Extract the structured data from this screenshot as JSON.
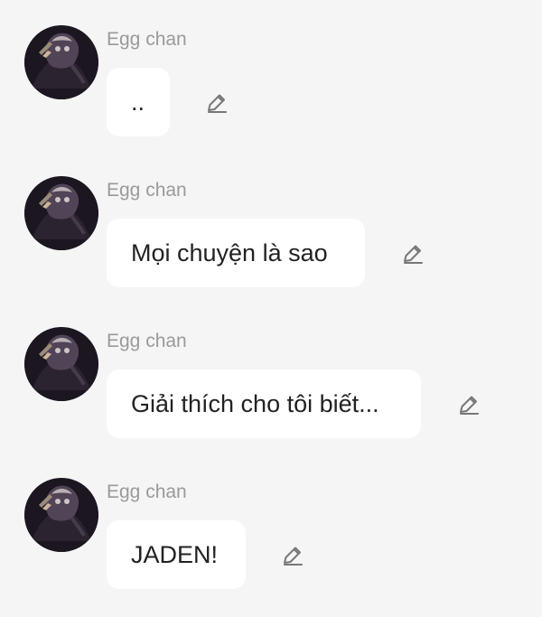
{
  "messages": [
    {
      "sender": "Egg chan",
      "text": "..",
      "avatar_icon": "user-avatar",
      "edit_icon": "pencil-icon"
    },
    {
      "sender": "Egg chan",
      "text": "Mọi chuyện là sao",
      "avatar_icon": "user-avatar",
      "edit_icon": "pencil-icon"
    },
    {
      "sender": "Egg chan",
      "text": "Giải thích cho tôi biết...",
      "avatar_icon": "user-avatar",
      "edit_icon": "pencil-icon"
    },
    {
      "sender": "Egg chan",
      "text": "JADEN!",
      "avatar_icon": "user-avatar",
      "edit_icon": "pencil-icon"
    }
  ],
  "colors": {
    "background": "#f5f5f5",
    "bubble": "#ffffff",
    "sender": "#9a9a9a",
    "text": "#222222",
    "icon": "#777777"
  }
}
